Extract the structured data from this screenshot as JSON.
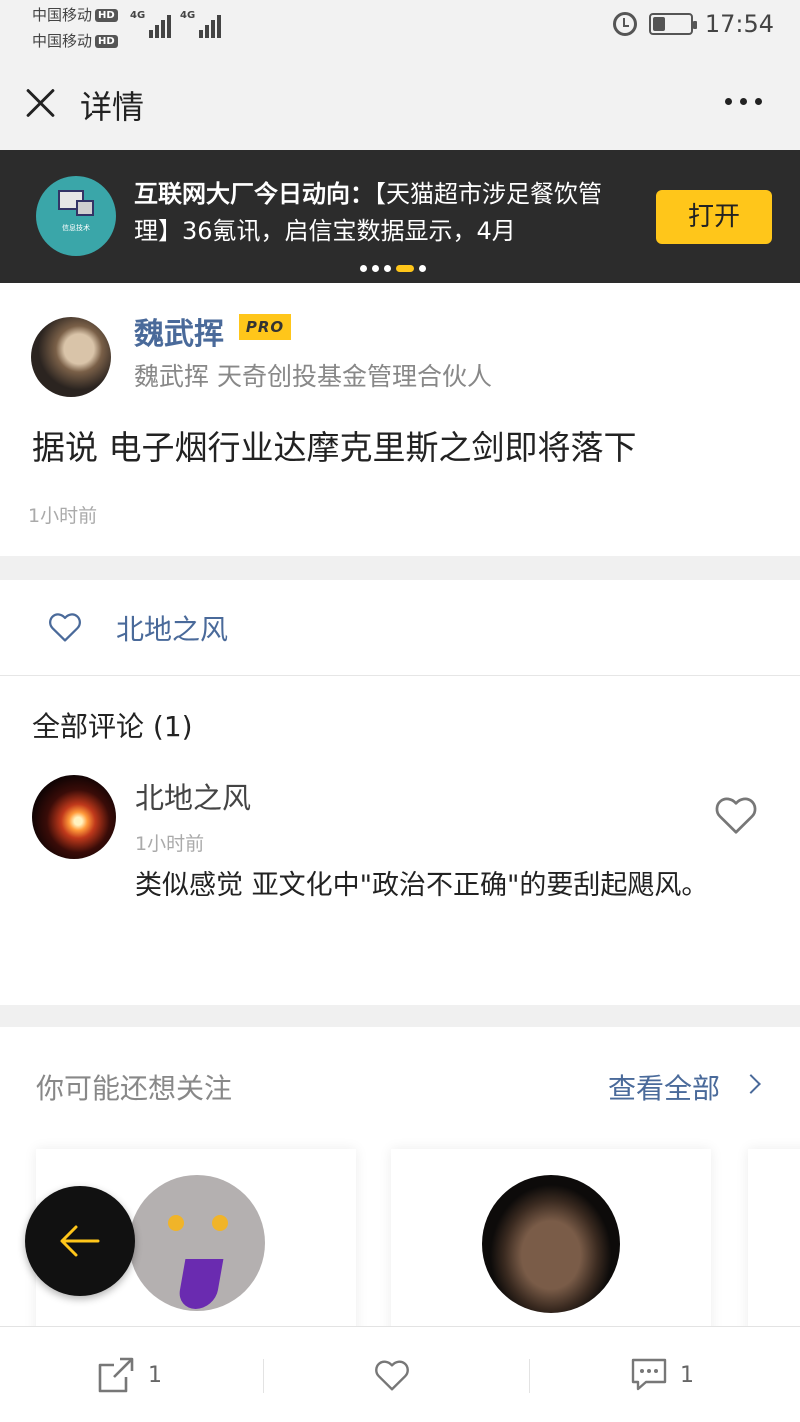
{
  "status_bar": {
    "carrier1": "中国移动",
    "carrier2": "中国移动",
    "hd": "HD",
    "network1": "4G",
    "network2": "4G",
    "time": "17:54",
    "battery_level": 0.35
  },
  "nav": {
    "title": "详情"
  },
  "banner": {
    "headline": "互联网大厂今日动向：",
    "body": "【天猫超市涉足餐饮管理】36氪讯，启信宝数据显示，4月",
    "logo_text": "信息技术",
    "open_label": "打开",
    "page_count": 5,
    "active_page": 4
  },
  "post": {
    "author": "魏武挥",
    "badge": "PRO",
    "author_desc": "魏武挥 天奇创投基金管理合伙人",
    "content": "据说 电子烟行业达摩克里斯之剑即将落下",
    "time": "1小时前"
  },
  "likes": {
    "users": "北地之风"
  },
  "comments": {
    "title": "全部评论 (1)",
    "items": [
      {
        "name": "北地之风",
        "time": "1小时前",
        "text": "类似感觉 亚文化中\"政治不正确\"的要刮起飓风。"
      }
    ]
  },
  "recommend": {
    "title": "你可能还想关注",
    "view_all": "查看全部"
  },
  "bottom_bar": {
    "share_count": "1",
    "comment_count": "1"
  },
  "colors": {
    "accent": "#ffc61a",
    "link_blue": "#4a6a9a",
    "banner_bg": "#2c2c2c"
  }
}
